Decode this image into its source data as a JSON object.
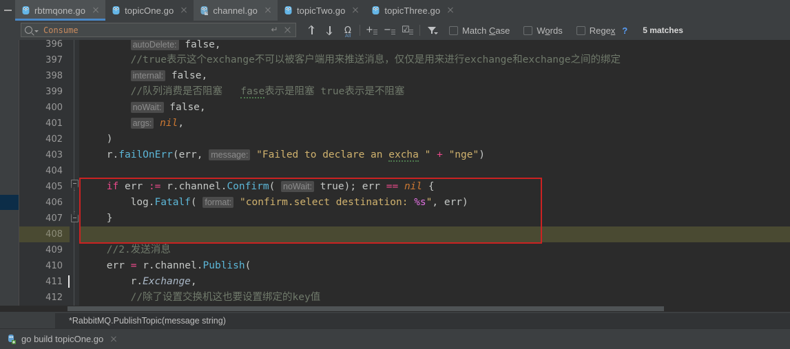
{
  "window": {
    "collapse_icon": "collapse-icon"
  },
  "tabs": [
    {
      "label": "rbtmqone.go",
      "icon": "go-file-icon",
      "active": true,
      "close_icon": "close-icon"
    },
    {
      "label": "topicOne.go",
      "icon": "go-file-icon",
      "active": false,
      "close_icon": "close-icon"
    },
    {
      "label": "channel.go",
      "icon": "go-file-readonly-icon",
      "active": false,
      "close_icon": "close-icon"
    },
    {
      "label": "topicTwo.go",
      "icon": "go-file-icon",
      "active": false,
      "close_icon": "close-icon"
    },
    {
      "label": "topicThree.go",
      "icon": "go-file-icon",
      "active": false,
      "close_icon": "close-icon"
    }
  ],
  "search": {
    "value": "Consume",
    "placeholder": "Search",
    "history_icon": "search-history-icon",
    "newline_icon": "insert-newline-icon",
    "clear_icon": "clear-icon",
    "prev_match_label": "Previous Occurrence",
    "next_match_label": "Next Occurrence",
    "select_all_label": "Select All Occurrences",
    "add_line_label": "Add Line",
    "remove_line_label": "Remove Line",
    "toggle_lines_label": "Toggle Selection",
    "filter_label": "Filter Search Results",
    "options": [
      {
        "label": "Match Case",
        "underline": "C",
        "checked": false
      },
      {
        "label": "Words",
        "underline": "o",
        "checked": false
      },
      {
        "label": "Regex",
        "underline": "x",
        "checked": false
      }
    ],
    "help_label": "?",
    "match_count": "5 matches"
  },
  "editor": {
    "first_line_number": 396,
    "current_line": 408,
    "lines": [
      {
        "n": 396,
        "partial": true,
        "html": "<span class=\"hintparam\">autoDelete:</span> <span class=\"ident\">false</span><span class=\"ident\">,</span>"
      },
      {
        "n": 397,
        "html": "<span class=\"cmt\">//true表示这个exchange不可以被客户端用来推送消息，仅仅是用来进行exchange和exchange之间的绑定</span>"
      },
      {
        "n": 398,
        "html": "<span class=\"hintparam\">internal:</span> <span class=\"ident\">false</span><span class=\"ident\">,</span>"
      },
      {
        "n": 399,
        "html": "<span class=\"cmt\">//队列消费是否阻塞   <span class=\"squiggle\">fase</span>表示是阻塞 true表示是不阻塞</span>"
      },
      {
        "n": 400,
        "html": "<span class=\"hintparam\">noWait:</span> <span class=\"ident\">false</span><span class=\"ident\">,</span>"
      },
      {
        "n": 401,
        "html": "<span class=\"hintparam\">args:</span> <span class=\"kw italic\">nil</span><span class=\"ident\">,</span>"
      },
      {
        "n": 402,
        "html": "<span class=\"ident\">)</span>"
      },
      {
        "n": 403,
        "html": "<span class=\"ident\">r.</span><span class=\"fn\">failOnErr</span><span class=\"ident\">(err, </span><span class=\"hintparam\">message:</span> <span class=\"str\">\"Failed to declare an <span class=\"squiggle\">excha</span> \"</span> <span class=\"kw2\">+</span> <span class=\"str\">\"nge\"</span><span class=\"ident\">)</span>"
      },
      {
        "n": 404,
        "html": ""
      },
      {
        "n": 405,
        "html": "<span class=\"kw2\">if</span> <span class=\"ident\">err</span> <span class=\"kw2\">:=</span> <span class=\"ident\">r.channel.</span><span class=\"fn\">Confirm</span><span class=\"ident\">(</span> <span class=\"hintparam\">noWait:</span> <span class=\"ident\">true); err</span> <span class=\"kw2\">==</span> <span class=\"kw italic\">nil</span> <span class=\"ident\">{</span>"
      },
      {
        "n": 406,
        "html": "<span class=\"ident\">log.</span><span class=\"fn\">Fatalf</span><span class=\"ident\">(</span> <span class=\"hintparam\">format:</span> <span class=\"str\">\"confirm.select destination: <span class=\"fmtspec\">%s</span>\"</span><span class=\"ident\">, err)</span>"
      },
      {
        "n": 407,
        "html": "<span class=\"ident\">}</span>"
      },
      {
        "n": 408,
        "html": ""
      },
      {
        "n": 409,
        "html": "<span class=\"cmt\">//2.发送消息</span>"
      },
      {
        "n": 410,
        "html": "<span class=\"ident\">err</span> <span class=\"kw2\">=</span> <span class=\"ident\">r.channel.</span><span class=\"fn\">Publish</span><span class=\"ident\">(</span>"
      },
      {
        "n": 411,
        "html": "<span class=\"ident\">r.</span><span class=\"fld italic\">Exchange</span><span class=\"ident\">,</span>"
      },
      {
        "n": 412,
        "html": "<span class=\"cmt\">//除了设置交换机这也要设置绑定的key值</span>"
      }
    ],
    "annotation_color": "#cc2222",
    "current_line_bg": "#4a4a32",
    "marker_color": "#0c2d48"
  },
  "breadcrumb": {
    "text": "*RabbitMQ.PublishTopic(message string)"
  },
  "bottom": {
    "label": "go build topicOne.go",
    "icon": "run-config-icon",
    "close_icon": "close-icon"
  },
  "colors": {
    "accent": "#4a88c7",
    "editor_bg": "#2b2b2b",
    "chrome_bg": "#3c3f41",
    "gutter_bg": "#313335"
  }
}
